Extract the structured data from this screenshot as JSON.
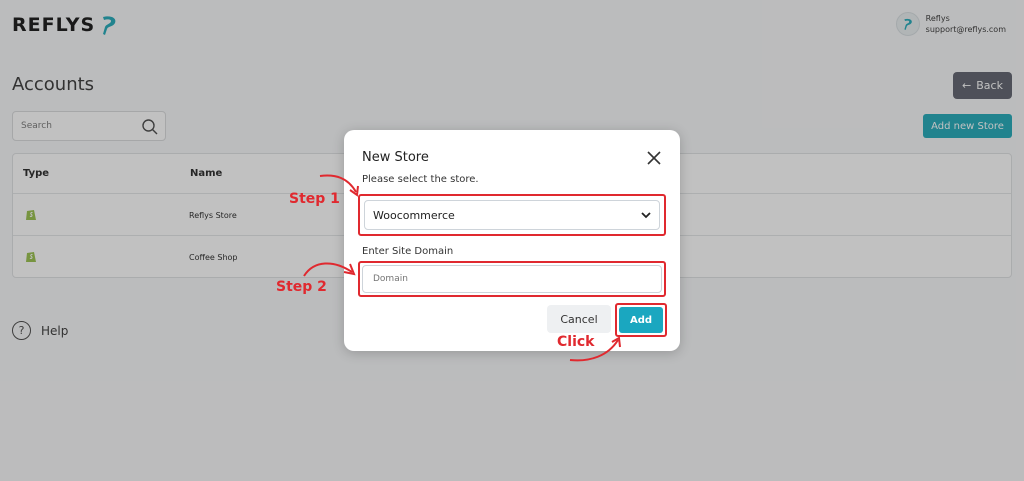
{
  "brand": {
    "name": "REFLYS"
  },
  "user": {
    "name": "Reflys",
    "email": "support@reflys.com"
  },
  "page": {
    "title": "Accounts",
    "back_label": "Back",
    "add_store_label": "Add new Store"
  },
  "search": {
    "placeholder": "Search"
  },
  "table": {
    "headers": [
      "Type",
      "Name"
    ],
    "rows": [
      {
        "type": "shopify-icon",
        "name": "Reflys Store"
      },
      {
        "type": "shopify-icon",
        "name": "Coffee Shop"
      }
    ]
  },
  "help": {
    "label": "Help"
  },
  "modal": {
    "title": "New Store",
    "subtitle": "Please select the store.",
    "selected_store": "Woocommerce",
    "domain_label": "Enter Site Domain",
    "domain_placeholder": "Domain",
    "cancel_label": "Cancel",
    "add_label": "Add"
  },
  "annotations": {
    "step1": "Step 1",
    "step2": "Step 2",
    "click": "Click"
  },
  "colors": {
    "accent": "#1aa7b7",
    "annotation": "#e0292f",
    "back_button": "#5b5e6b"
  }
}
